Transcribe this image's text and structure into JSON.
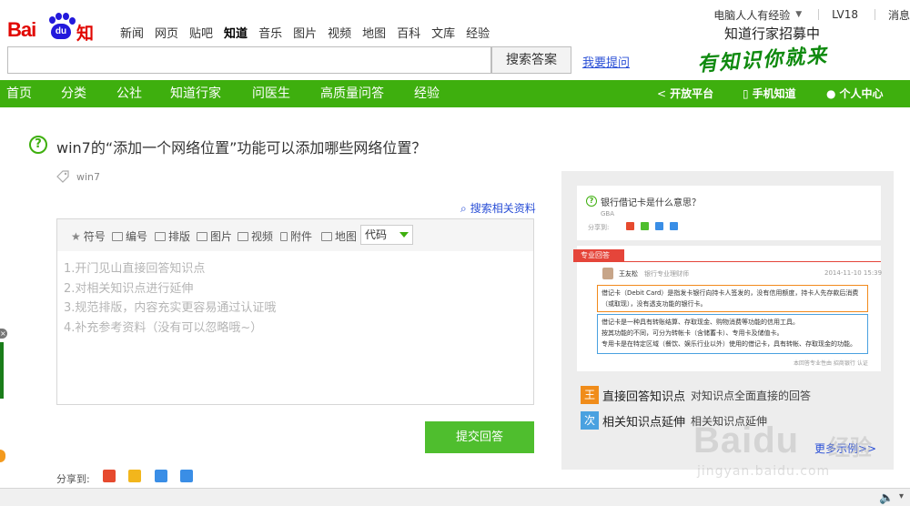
{
  "header": {
    "logo": {
      "brand": "Bai",
      "paw_text": "du",
      "product": "知道"
    },
    "nav": [
      "新闻",
      "网页",
      "贴吧",
      "知道",
      "音乐",
      "图片",
      "视频",
      "地图",
      "百科",
      "文库",
      "经验"
    ],
    "active_nav": "知道",
    "search": {
      "value": "",
      "button": "搜索答案",
      "ask_link": "我要提问"
    },
    "user": {
      "name": "电脑人人有经验",
      "level": "LV18",
      "message": "消息"
    },
    "recruit": "知道行家招募中",
    "slogan": "有知识你就来"
  },
  "green_nav": {
    "left": [
      "首页",
      "分类",
      "公社",
      "知道行家",
      "问医生",
      "高质量问答",
      "经验"
    ],
    "right": [
      {
        "icon": "share-icon",
        "label": "开放平台"
      },
      {
        "icon": "phone-icon",
        "label": "手机知道"
      },
      {
        "icon": "person-icon",
        "label": "个人中心"
      }
    ]
  },
  "question": {
    "title": "win7的“添加一个网络位置”功能可以添加哪些网络位置？",
    "tag": "win7"
  },
  "search_related": "搜索相关资料",
  "editor": {
    "tools": [
      "符号",
      "编号",
      "排版",
      "图片",
      "视频",
      "附件",
      "地图"
    ],
    "code_select": "代码",
    "hints": [
      "1.开门见山直接回答知识点",
      "2.对相关知识点进行延伸",
      "3.规范排版，内容充实更容易通过认证哦",
      "4.补充参考资料（没有可以忽略哦~）"
    ]
  },
  "submit": "提交回答",
  "share_label": "分享到:",
  "sample": {
    "question": "银行借记卡是什么意思？",
    "tag": "GBA",
    "share": "分享到:",
    "pro_tag": "专业回答",
    "answerer": "王友松",
    "role": "银行专业理财师",
    "date": "2014-11-10  15:39",
    "para1": "借记卡（Debit Card）是指发卡银行向持卡人签发的，没有信用额度，持卡人先存款后消费（或取现），没有透支功能的银行卡。",
    "para2": [
      "借记卡是一种具有转账结算、存取现金、购物消费等功能的信用工具。",
      "按其功能的不同，可分为转帐卡（含储蓄卡）、专用卡及储值卡。",
      "专用卡是在特定区域（餐饮、娱乐行业以外）使用的借记卡，具有转帐、存取现金的功能。"
    ],
    "footer": "本回答专业性由 招商银行 认证"
  },
  "knowledge": [
    {
      "badge": "王",
      "color": "#f08c1a",
      "title": "直接回答知识点",
      "desc": "对知识点全面直接的回答"
    },
    {
      "badge": "次",
      "color": "#4aa1e0",
      "title": "相关知识点延伸",
      "desc": "相关知识点延伸"
    }
  ],
  "more_link": "更多示例>>",
  "watermark": {
    "brand": "Baidu",
    "cn": "经验",
    "url": "jingyan.baidu.com"
  }
}
